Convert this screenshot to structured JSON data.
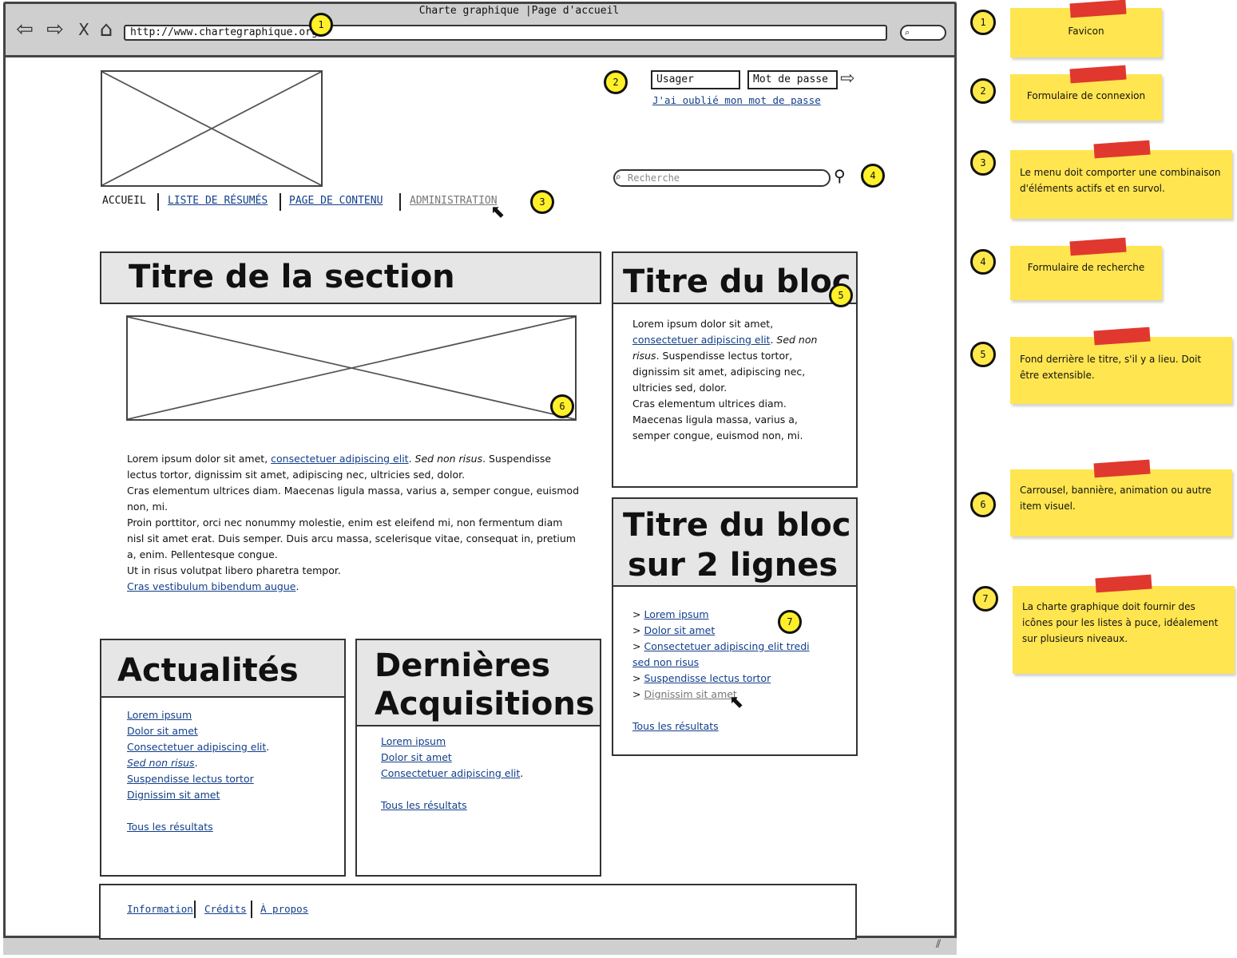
{
  "window": {
    "title": "Charte graphique  |Page d'accueil",
    "url": "http://www.chartegraphique.org/",
    "back_icon": "arrow-left-icon",
    "forward_icon": "arrow-right-icon",
    "stop_label": "X",
    "home_icon": "home-icon"
  },
  "login": {
    "user_placeholder": "Usager",
    "password_placeholder": "Mot de passe",
    "forgot_link": "J'ai oublié mon mot de passe"
  },
  "search": {
    "placeholder": "Recherche"
  },
  "nav": {
    "items": [
      {
        "label": "ACCUEIL",
        "state": "active"
      },
      {
        "label": "LISTE DE RÉSUMÉS",
        "state": "link"
      },
      {
        "label": "PAGE DE CONTENU",
        "state": "link"
      },
      {
        "label": "ADMINISTRATION",
        "state": "hover"
      }
    ]
  },
  "main_section": {
    "title": "Titre de la section",
    "p1_start": "Lorem ipsum dolor sit amet, ",
    "p1_link": "consectetuer adipiscing elit",
    "p1_dot": ". ",
    "p1_italic": "Sed non risus",
    "p1_end": ". Suspendisse lectus tortor, dignissim sit amet, adipiscing nec, ultricies sed, dolor.",
    "p2": "Cras elementum ultrices diam. Maecenas ligula massa, varius a, semper congue, euismod non, mi.",
    "p3": "Proin porttitor, orci nec nonummy molestie, enim est eleifend mi, non fermentum diam nisl sit amet erat. Duis semper. Duis arcu massa, scelerisque vitae, consequat in, pretium a, enim. Pellentesque congue.",
    "p4": "Ut in risus volutpat libero pharetra tempor.",
    "p5_link": "Cras vestibulum bibendum augue",
    "p5_end": "."
  },
  "block1": {
    "title": "Titre du bloc",
    "t1": "Lorem ipsum dolor sit amet,",
    "link": "consectetuer adipiscing elit",
    "t2": ". ",
    "italic": "Sed non risus",
    "t3": ". Suspendisse lectus tortor, dignissim sit amet, adipiscing nec, ultricies sed, dolor.",
    "t4": "Cras elementum ultrices diam. Maecenas ligula massa, varius a, semper congue, euismod non, mi."
  },
  "block2": {
    "title_line1": "Titre du bloc",
    "title_line2": "sur 2 lignes",
    "bullet": ">",
    "items": [
      "Lorem ipsum",
      "Dolor sit amet",
      "Consectetuer adipiscing elit tredi sed non risus",
      "Suspendisse lectus tortor",
      "Dignissim sit amet"
    ],
    "all_results": "Tous les résultats"
  },
  "news": {
    "title": "Actualités",
    "items": [
      "Lorem ipsum",
      "Dolor sit amet",
      "Consectetuer adipiscing elit",
      "Sed non risus",
      "Suspendisse lectus tortor",
      "Dignissim sit amet"
    ],
    "all_results": "Tous les résultats"
  },
  "acquisitions": {
    "title_line1": "Dernières",
    "title_line2": "Acquisitions",
    "items": [
      "Lorem ipsum",
      "Dolor sit amet",
      "Consectetuer adipiscing elit"
    ],
    "all_results": "Tous les résultats"
  },
  "footer": {
    "links": [
      "Information",
      "Crédits",
      "À propos"
    ]
  },
  "markers": [
    "1",
    "2",
    "3",
    "4",
    "5",
    "6",
    "7"
  ],
  "notes": [
    {
      "num": "1",
      "text": "Favicon"
    },
    {
      "num": "2",
      "text": "Formulaire de connexion"
    },
    {
      "num": "3",
      "text": "Le menu doit comporter une combinaison d'éléments actifs et en survol."
    },
    {
      "num": "4",
      "text": "Formulaire de recherche"
    },
    {
      "num": "5",
      "text": "Fond derrière le titre, s'il y a lieu. Doit être extensible."
    },
    {
      "num": "6",
      "text": "Carrousel, bannière, animation ou autre item visuel."
    },
    {
      "num": "7",
      "text": "La charte graphique doit fournir des icônes pour les listes à puce, idéalement sur plusieurs niveaux."
    }
  ],
  "colors": {
    "link": "#123f8a",
    "note": "#ffe550",
    "tape": "#e0382e",
    "marker": "#fff02a",
    "panel_head": "#e6e6e6"
  }
}
